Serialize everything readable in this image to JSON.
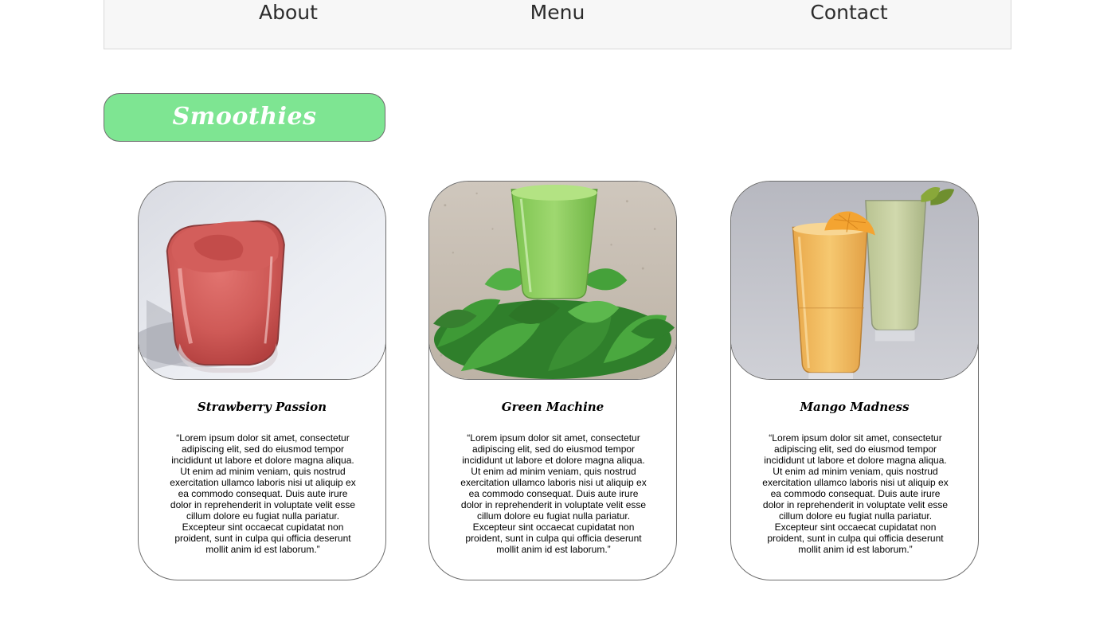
{
  "nav": {
    "links": [
      "About",
      "Menu",
      "Contact"
    ]
  },
  "section": {
    "title": "Smoothies",
    "accent_color": "#7ee592"
  },
  "cards": [
    {
      "name": "Strawberry Passion",
      "image_icon": "strawberry-smoothie-image",
      "description": "“Lorem ipsum dolor sit amet, consectetur adipiscing elit, sed do eiusmod tempor incididunt ut labore et dolore magna aliqua. Ut enim ad minim veniam, quis nostrud exercitation ullamco laboris nisi ut aliquip ex ea commodo consequat. Duis aute irure dolor in reprehenderit in voluptate velit esse cillum dolore eu fugiat nulla pariatur. Excepteur sint occaecat cupidatat non proident, sunt in culpa qui officia deserunt mollit anim id est laborum.”"
    },
    {
      "name": "Green Machine",
      "image_icon": "green-smoothie-image",
      "description": "“Lorem ipsum dolor sit amet, consectetur adipiscing elit, sed do eiusmod tempor incididunt ut labore et dolore magna aliqua. Ut enim ad minim veniam, quis nostrud exercitation ullamco laboris nisi ut aliquip ex ea commodo consequat. Duis aute irure dolor in reprehenderit in voluptate velit esse cillum dolore eu fugiat nulla pariatur. Excepteur sint occaecat cupidatat non proident, sunt in culpa qui officia deserunt mollit anim id est laborum.”"
    },
    {
      "name": "Mango Madness",
      "image_icon": "mango-smoothie-image",
      "description": "“Lorem ipsum dolor sit amet, consectetur adipiscing elit, sed do eiusmod tempor incididunt ut labore et dolore magna aliqua. Ut enim ad minim veniam, quis nostrud exercitation ullamco laboris nisi ut aliquip ex ea commodo consequat. Duis aute irure dolor in reprehenderit in voluptate velit esse cillum dolore eu fugiat nulla pariatur. Excepteur sint occaecat cupidatat non proident, sunt in culpa qui officia deserunt mollit anim id est laborum.”"
    }
  ]
}
